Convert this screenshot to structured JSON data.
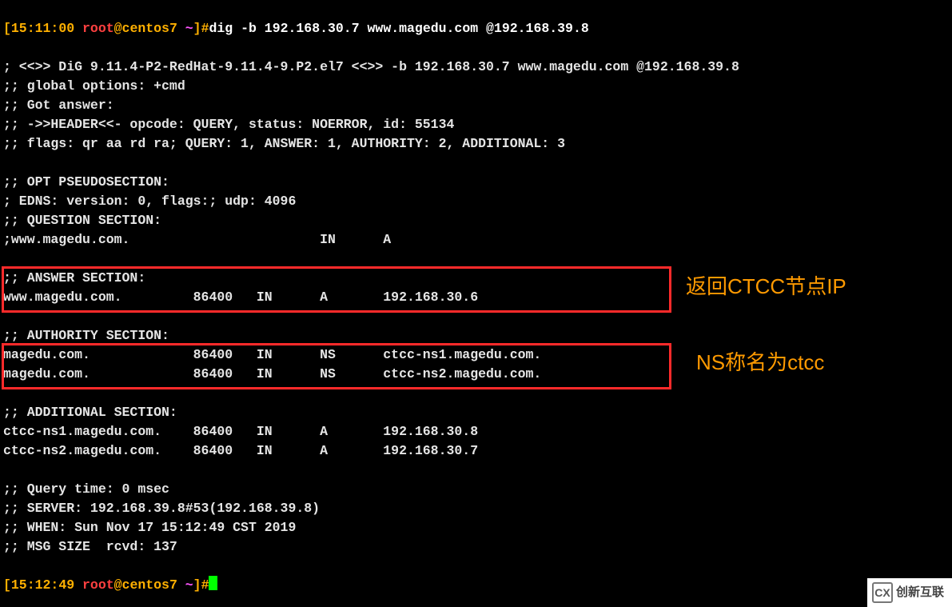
{
  "prompt1": {
    "time": "15:11:00",
    "user": "root",
    "host": "@centos7",
    "path": " ~",
    "hash": "]#",
    "cmd": "dig -b 192.168.30.7 www.magedu.com @192.168.39.8"
  },
  "out": {
    "l1": "",
    "l2": "; <<>> DiG 9.11.4-P2-RedHat-9.11.4-9.P2.el7 <<>> -b 192.168.30.7 www.magedu.com @192.168.39.8",
    "l3": ";; global options: +cmd",
    "l4": ";; Got answer:",
    "l5": ";; ->>HEADER<<- opcode: QUERY, status: NOERROR, id: 55134",
    "l6": ";; flags: qr aa rd ra; QUERY: 1, ANSWER: 1, AUTHORITY: 2, ADDITIONAL: 3",
    "l7": "",
    "l8": ";; OPT PSEUDOSECTION:",
    "l9": "; EDNS: version: 0, flags:; udp: 4096",
    "l10": ";; QUESTION SECTION:",
    "l11": ";www.magedu.com.                        IN      A",
    "l12": "",
    "l13": ";; ANSWER SECTION:",
    "l14": "www.magedu.com.         86400   IN      A       192.168.30.6",
    "l15": "",
    "l16": ";; AUTHORITY SECTION:",
    "l17": "magedu.com.             86400   IN      NS      ctcc-ns1.magedu.com.",
    "l18": "magedu.com.             86400   IN      NS      ctcc-ns2.magedu.com.",
    "l19": "",
    "l20": ";; ADDITIONAL SECTION:",
    "l21": "ctcc-ns1.magedu.com.    86400   IN      A       192.168.30.8",
    "l22": "ctcc-ns2.magedu.com.    86400   IN      A       192.168.30.7",
    "l23": "",
    "l24": ";; Query time: 0 msec",
    "l25": ";; SERVER: 192.168.39.8#53(192.168.39.8)",
    "l26": ";; WHEN: Sun Nov 17 15:12:49 CST 2019",
    "l27": ";; MSG SIZE  rcvd: 137",
    "l28": ""
  },
  "prompt2": {
    "time": "15:12:49",
    "user": "root",
    "host": "@centos7",
    "path": " ~",
    "hash": "]#"
  },
  "annot1": "返回CTCC节点IP",
  "annot2": "NS称名为ctcc",
  "watermark": "创新互联"
}
